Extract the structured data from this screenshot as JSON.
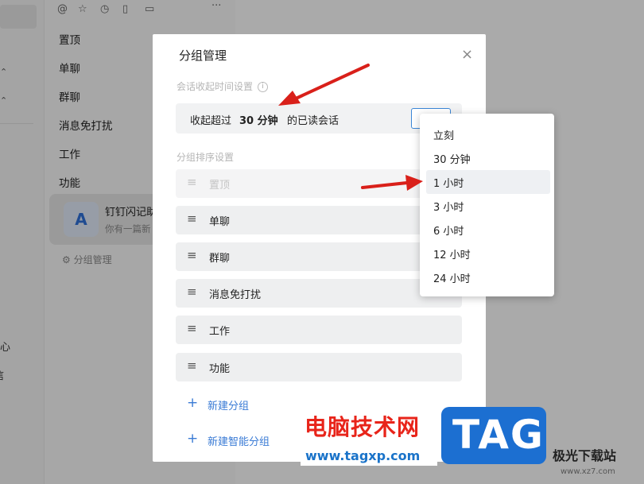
{
  "left_rail": {
    "text_fragment_1": "心",
    "text_fragment_2": "信"
  },
  "mid_panel": {
    "toolbar_more": "···",
    "items": [
      "置顶",
      "单聊",
      "群聊",
      "消息免打扰",
      "工作",
      "功能"
    ],
    "chat": {
      "title": "钉钉闪记助",
      "subtitle": "你有一篇新"
    },
    "group_manage": "分组管理"
  },
  "dialog": {
    "title": "分组管理",
    "close": "×",
    "collapse_section": "会话收起时间设置",
    "collapse_row": {
      "prefix": "收起超过",
      "value": "30 分钟",
      "suffix": "的已读会话"
    },
    "sort_section": "分组排序设置",
    "groups": [
      "置顶",
      "单聊",
      "群聊",
      "消息免打扰",
      "工作",
      "功能"
    ],
    "new_group": "新建分组",
    "new_smart_group": "新建智能分组"
  },
  "dropdown": {
    "options": [
      "立刻",
      "30 分钟",
      "1 小时",
      "3 小时",
      "6 小时",
      "12 小时",
      "24 小时"
    ],
    "highlighted": "1 小时"
  },
  "watermark": {
    "cn_text": "电脑技术网",
    "url": "www.tagxp.com",
    "tag": "TAG",
    "site_name": "极光下载站",
    "site_url": "www.xz7.com"
  },
  "colors": {
    "accent": "#3a7bd5",
    "arrow": "#d9201a"
  }
}
